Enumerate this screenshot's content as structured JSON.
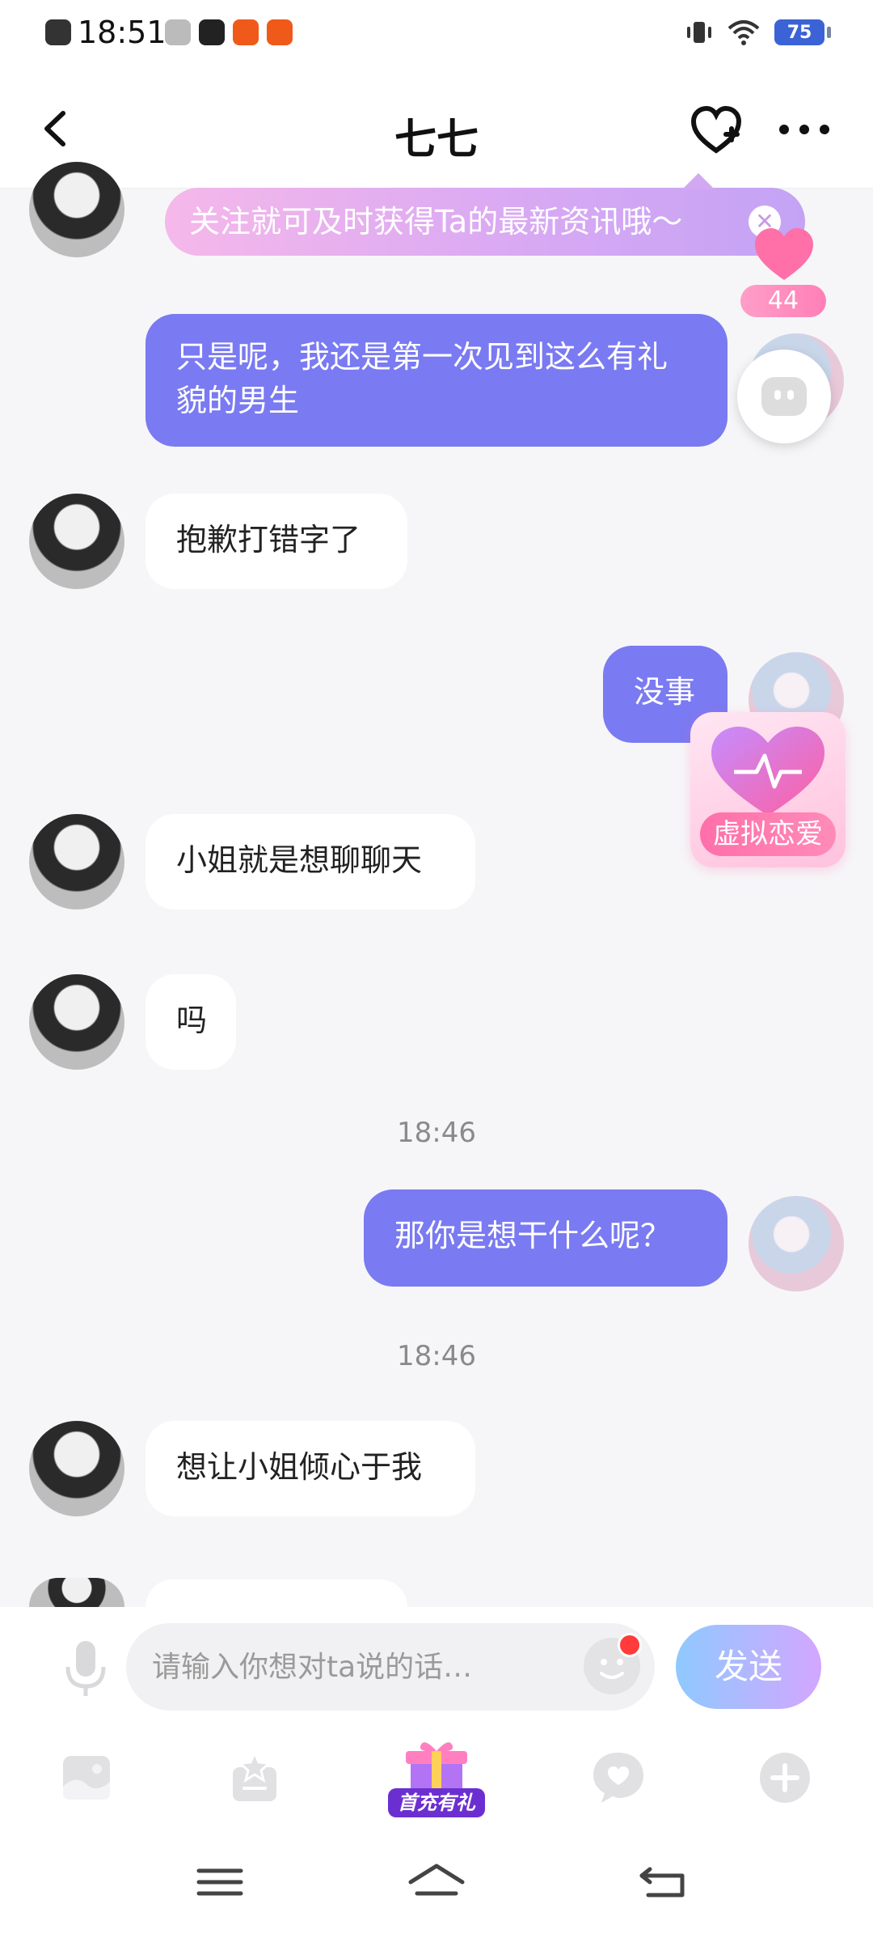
{
  "status_bar": {
    "time": "18:51",
    "battery": "75"
  },
  "header": {
    "title": "七七"
  },
  "follow_banner": {
    "text": "关注就可及时获得Ta的最新资讯哦～"
  },
  "floating": {
    "score": "44",
    "love_label": "虚拟恋爱"
  },
  "messages": [
    {
      "from": "self",
      "text": "只是呢，我还是第一次见到这么有礼貌的男生"
    },
    {
      "from": "other",
      "text": "抱歉打错字了"
    },
    {
      "from": "self",
      "text": "没事"
    },
    {
      "from": "other",
      "text": "小姐就是想聊聊天"
    },
    {
      "from": "other",
      "text": "吗"
    },
    {
      "type": "time",
      "text": "18:46"
    },
    {
      "from": "self",
      "text": "那你是想干什么呢？"
    },
    {
      "type": "time",
      "text": "18:46"
    },
    {
      "from": "other",
      "text": "想让小姐倾心于我"
    }
  ],
  "composer": {
    "placeholder": "请输入你想对ta说的话…",
    "send_label": "发送"
  },
  "tools": {
    "gift_label": "首充有礼"
  },
  "colors": {
    "accent_bubble": "#7a7af2",
    "send_gradient_start": "#8fc9ff",
    "send_gradient_end": "#d3a6ff"
  }
}
